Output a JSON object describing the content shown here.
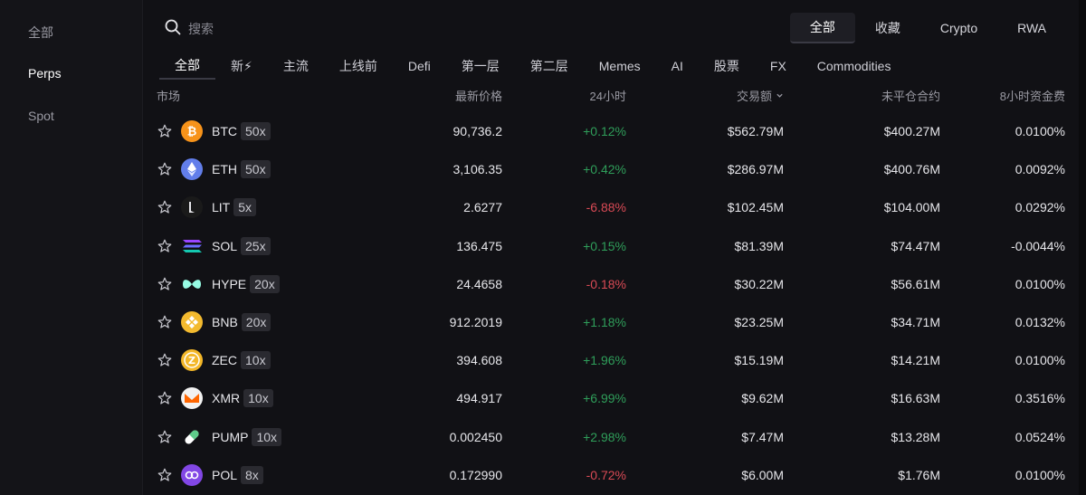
{
  "sidebar": {
    "items": [
      {
        "label": "全部",
        "active": false
      },
      {
        "label": "Perps",
        "active": true
      },
      {
        "label": "Spot",
        "active": false
      }
    ]
  },
  "search": {
    "placeholder": "搜索",
    "icon": "search-icon"
  },
  "top_tabs": [
    {
      "label": "全部",
      "active": true
    },
    {
      "label": "收藏",
      "active": false
    },
    {
      "label": "Crypto",
      "active": false
    },
    {
      "label": "RWA",
      "active": false
    }
  ],
  "category_tabs": [
    {
      "label": "全部",
      "active": true
    },
    {
      "label": "新⚡",
      "active": false
    },
    {
      "label": "主流",
      "active": false
    },
    {
      "label": "上线前",
      "active": false
    },
    {
      "label": "Defi",
      "active": false
    },
    {
      "label": "第一层",
      "active": false
    },
    {
      "label": "第二层",
      "active": false
    },
    {
      "label": "Memes",
      "active": false
    },
    {
      "label": "AI",
      "active": false
    },
    {
      "label": "股票",
      "active": false
    },
    {
      "label": "FX",
      "active": false
    },
    {
      "label": "Commodities",
      "active": false
    }
  ],
  "table": {
    "headers": {
      "market": "市场",
      "price": "最新价格",
      "change": "24小时",
      "volume": "交易额",
      "open_interest": "未平仓合约",
      "funding": "8小时资金费"
    },
    "rows": [
      {
        "symbol": "BTC",
        "leverage": "50x",
        "price": "90,736.2",
        "change": "+0.12%",
        "direction": "up",
        "volume": "$562.79M",
        "open_interest": "$400.27M",
        "funding": "0.0100%",
        "icon": "btc-icon",
        "color": "#f7931a"
      },
      {
        "symbol": "ETH",
        "leverage": "50x",
        "price": "3,106.35",
        "change": "+0.42%",
        "direction": "up",
        "volume": "$286.97M",
        "open_interest": "$400.76M",
        "funding": "0.0092%",
        "icon": "eth-icon",
        "color": "#627eea"
      },
      {
        "symbol": "LIT",
        "leverage": "5x",
        "price": "2.6277",
        "change": "-6.88%",
        "direction": "down",
        "volume": "$102.45M",
        "open_interest": "$104.00M",
        "funding": "0.0292%",
        "icon": "lit-icon",
        "color": "#1a1a1a"
      },
      {
        "symbol": "SOL",
        "leverage": "25x",
        "price": "136.475",
        "change": "+0.15%",
        "direction": "up",
        "volume": "$81.39M",
        "open_interest": "$74.47M",
        "funding": "-0.0044%",
        "icon": "sol-icon",
        "color": "#9945ff"
      },
      {
        "symbol": "HYPE",
        "leverage": "20x",
        "price": "24.4658",
        "change": "-0.18%",
        "direction": "down",
        "volume": "$30.22M",
        "open_interest": "$56.61M",
        "funding": "0.0100%",
        "icon": "hype-icon",
        "color": "#97fce4"
      },
      {
        "symbol": "BNB",
        "leverage": "20x",
        "price": "912.2019",
        "change": "+1.18%",
        "direction": "up",
        "volume": "$23.25M",
        "open_interest": "$34.71M",
        "funding": "0.0132%",
        "icon": "bnb-icon",
        "color": "#f3ba2f"
      },
      {
        "symbol": "ZEC",
        "leverage": "10x",
        "price": "394.608",
        "change": "+1.96%",
        "direction": "up",
        "volume": "$15.19M",
        "open_interest": "$14.21M",
        "funding": "0.0100%",
        "icon": "zec-icon",
        "color": "#f4b728"
      },
      {
        "symbol": "XMR",
        "leverage": "10x",
        "price": "494.917",
        "change": "+6.99%",
        "direction": "up",
        "volume": "$9.62M",
        "open_interest": "$16.63M",
        "funding": "0.3516%",
        "icon": "xmr-icon",
        "color": "#ff6600"
      },
      {
        "symbol": "PUMP",
        "leverage": "10x",
        "price": "0.002450",
        "change": "+2.98%",
        "direction": "up",
        "volume": "$7.47M",
        "open_interest": "$13.28M",
        "funding": "0.0524%",
        "icon": "pump-icon",
        "color": "#5fcb8a"
      },
      {
        "symbol": "POL",
        "leverage": "8x",
        "price": "0.172990",
        "change": "-0.72%",
        "direction": "down",
        "volume": "$6.00M",
        "open_interest": "$1.76M",
        "funding": "0.0100%",
        "icon": "pol-icon",
        "color": "#8247e5"
      }
    ]
  },
  "colors": {
    "up": "#2f9e5a",
    "down": "#d94a55",
    "background": "#111115"
  }
}
